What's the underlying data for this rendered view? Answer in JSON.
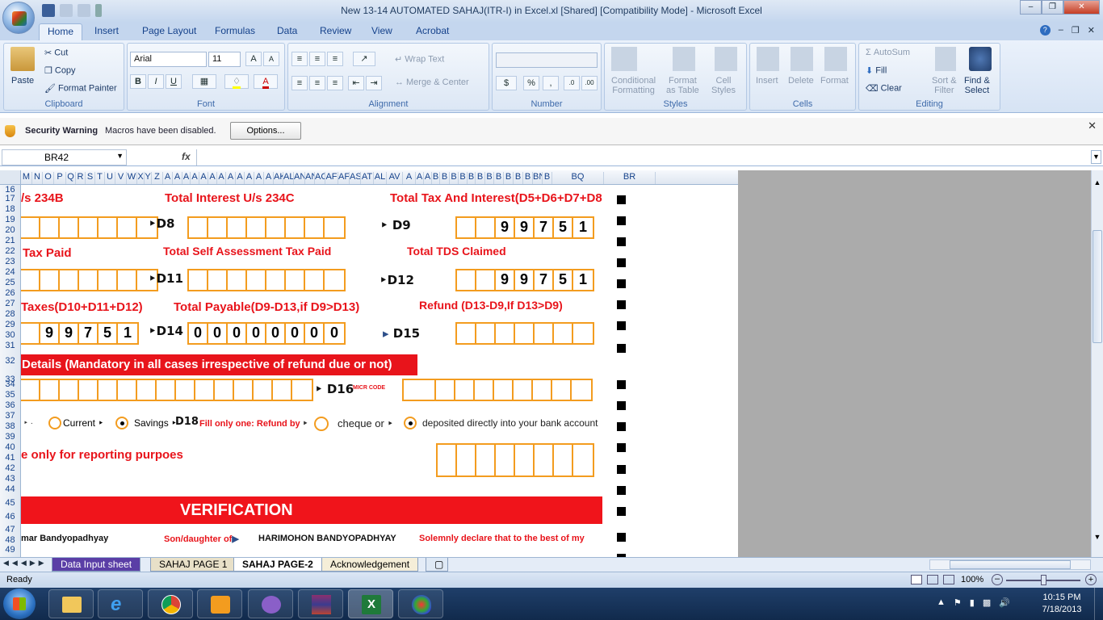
{
  "window": {
    "title": "New 13-14 AUTOMATED SAHAJ(ITR-I) in Excel.xl  [Shared]  [Compatibility Mode] - Microsoft Excel"
  },
  "ribbon_tabs": [
    "Home",
    "Insert",
    "Page Layout",
    "Formulas",
    "Data",
    "Review",
    "View",
    "Acrobat"
  ],
  "clipboard": {
    "paste": "Paste",
    "cut": "Cut",
    "copy": "Copy",
    "format_painter": "Format Painter",
    "label": "Clipboard"
  },
  "font": {
    "name": "Arial",
    "size": "11",
    "label": "Font",
    "bold": "B",
    "italic": "I",
    "underline": "U"
  },
  "alignment": {
    "wrap": "Wrap Text",
    "merge": "Merge & Center",
    "label": "Alignment"
  },
  "number": {
    "label": "Number",
    "currency": "$",
    "percent": "%",
    "comma": ","
  },
  "styles": {
    "cond": "Conditional",
    "cond2": "Formatting",
    "fmt": "Format",
    "fmt2": "as Table",
    "cell": "Cell",
    "cell2": "Styles",
    "label": "Styles"
  },
  "cells": {
    "insert": "Insert",
    "delete": "Delete",
    "format": "Format",
    "label": "Cells"
  },
  "editing": {
    "autosum": "AutoSum",
    "fill": "Fill",
    "clear": "Clear",
    "sort": "Sort &",
    "sort2": "Filter",
    "find": "Find &",
    "find2": "Select",
    "label": "Editing"
  },
  "security": {
    "title": "Security Warning",
    "message": "Macros have been disabled.",
    "options": "Options..."
  },
  "formula_bar": {
    "name_box": "BR42",
    "fx": "fx"
  },
  "columns": [
    "M",
    "N",
    "O",
    "P",
    "Q",
    "R",
    "S",
    "T",
    "U",
    "V",
    "W",
    "X",
    "Y",
    "Z",
    "A",
    "A",
    "A",
    "A",
    "A",
    "A",
    "A",
    "A",
    "A",
    "A",
    "A",
    "A",
    "AK",
    "AL",
    "AN",
    "AN",
    "AC",
    "AF",
    "AF",
    "AS",
    "AT",
    "AL",
    "AV",
    "A",
    "A",
    "A",
    "B",
    "B",
    "B",
    "B",
    "B",
    "B",
    "B",
    "B",
    "B",
    "B",
    "B",
    "BN",
    "B",
    "BQ",
    "BR"
  ],
  "rows": [
    "16",
    "17",
    "18",
    "19",
    "20",
    "21",
    "22",
    "23",
    "24",
    "25",
    "26",
    "27",
    "28",
    "29",
    "30",
    "31",
    "32",
    "33",
    "34",
    "35",
    "36",
    "37",
    "38",
    "39",
    "40",
    "41",
    "42",
    "43",
    "44",
    "45",
    "46",
    "47",
    "48",
    "49"
  ],
  "form": {
    "l_234b": "/s 234B",
    "l_234c": "Total Interest U/s 234C",
    "l_total_tax": "Total Tax And Interest(D5+D6+D7+D8",
    "d8": "D8",
    "d9": "D9",
    "d9_digits": [
      "",
      "",
      "9",
      "9",
      "7",
      "5",
      "1"
    ],
    "l_tax_paid": "Tax Paid",
    "l_self": "Total Self Assessment Tax Paid",
    "l_tds": "Total TDS Claimed",
    "d11": "D11",
    "d12": "D12",
    "d12_digits": [
      "",
      "",
      "9",
      "9",
      "7",
      "5",
      "1"
    ],
    "l_taxes": "Taxes(D10+D11+D12)",
    "l_payable": "Total Payable(D9-D13,if D9>D13)",
    "l_refund": "Refund (D13-D9,If D13>D9)",
    "d13_digits": [
      "",
      "9",
      "9",
      "7",
      "5",
      "1"
    ],
    "d14": "D14",
    "d14_digits": [
      "0",
      "0",
      "0",
      "0",
      "0",
      "0",
      "0",
      "0"
    ],
    "d15": "D15",
    "l_bank": "Details (Mandatory in all cases irrespective of refund due or not)",
    "d16": "D16",
    "micr": "MICR CODE",
    "current": "Current",
    "savings": "Savings",
    "d18": "D18",
    "fill_only": "Fill only one: Refund by",
    "cheque": "cheque or",
    "deposited": "deposited directly into your bank account",
    "reporting": "e only for reporting purpoes",
    "verification": "VERIFICATION",
    "name_part": "mar Bandyopadhyay",
    "son": "Son/daughter of",
    "father": "HARIMOHON BANDYOPADHYAY",
    "declare": "Solemnly declare that to the best of my"
  },
  "sheet_tabs": [
    "Data Input sheet",
    "SAHAJ PAGE 1",
    "SAHAJ PAGE-2",
    "Acknowledgement"
  ],
  "status": {
    "ready": "Ready",
    "zoom": "100%"
  },
  "clock": {
    "time": "10:15 PM",
    "date": "7/18/2013"
  },
  "colors": {
    "accent": "#e8141b",
    "box": "#f39c1f"
  }
}
